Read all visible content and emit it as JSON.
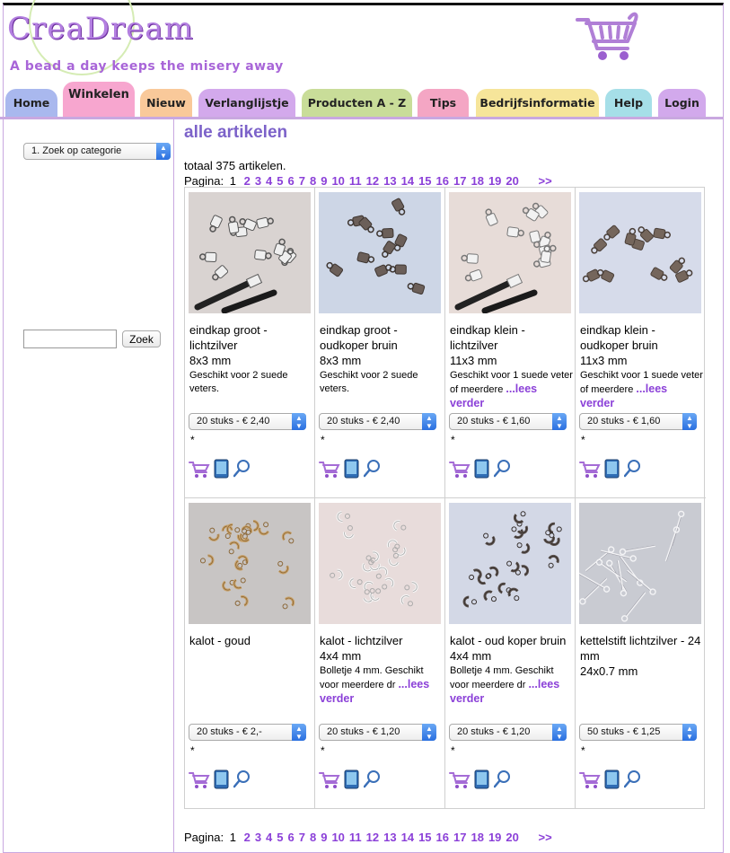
{
  "header": {
    "logo": "CreaDream",
    "tagline": "A bead a day keeps the misery away"
  },
  "colors": {
    "accent": "#8b40d8",
    "title": "#7c62c9",
    "frame": "#c9a8e0"
  },
  "tabs": [
    {
      "label": "Home",
      "color": "#a9b8ee"
    },
    {
      "label": "Winkelen",
      "color": "#f7a6cf",
      "active": true
    },
    {
      "label": "Nieuw",
      "color": "#f9c99a"
    },
    {
      "label": "Verlanglijstje",
      "color": "#d3a9ec"
    },
    {
      "label": "Producten A - Z",
      "color": "#c9dd99"
    },
    {
      "label": "Tips",
      "color": "#f4a6c4"
    },
    {
      "label": "Bedrijfsinformatie",
      "color": "#f6e59a"
    },
    {
      "label": "Help",
      "color": "#a6dfe8"
    },
    {
      "label": "Login",
      "color": "#d2a9ec"
    }
  ],
  "sidebar": {
    "category_select": "1. Zoek op categorie",
    "search_button": "Zoek",
    "search_value": ""
  },
  "main": {
    "title": "alle artikelen",
    "total": "totaal 375 artikelen.",
    "pagination": {
      "label": "Pagina:",
      "current": "1",
      "pages": [
        "2",
        "3",
        "4",
        "5",
        "6",
        "7",
        "8",
        "9",
        "10",
        "11",
        "12",
        "13",
        "14",
        "15",
        "16",
        "17",
        "18",
        "19",
        "20"
      ],
      "next": ">>"
    }
  },
  "products": [
    {
      "name": "eindkap groot - lichtzilver",
      "size": "8x3 mm",
      "desc": "Geschikt voor 2 suede veters.",
      "more": "",
      "option": "20 stuks - € 2,40",
      "star": "*",
      "image": {
        "bg": "#d9d3d1",
        "part": "#efefef",
        "dark": "#555",
        "style": "crimp",
        "cord": true
      }
    },
    {
      "name": "eindkap groot - oudkoper bruin",
      "size": "8x3 mm",
      "desc": "Geschikt voor 2 suede veters.",
      "more": "",
      "option": "20 stuks - € 2,40",
      "star": "*",
      "image": {
        "bg": "#cdd6e6",
        "part": "#6b5f59",
        "dark": "#3d3530",
        "style": "crimp",
        "cord": false
      }
    },
    {
      "name": "eindkap klein - lichtzilver",
      "size": "11x3 mm",
      "desc": "Geschikt voor 1 suede veter of meerdere ",
      "more": "...lees verder",
      "option": "20 stuks - € 1,60",
      "star": "*",
      "image": {
        "bg": "#e7dcd8",
        "part": "#f2f2f2",
        "dark": "#777",
        "style": "crimp",
        "cord": true
      }
    },
    {
      "name": "eindkap klein - oudkoper bruin",
      "size": "11x3 mm",
      "desc": "Geschikt voor 1 suede veter of meerdere ",
      "more": "...lees verder",
      "option": "20 stuks - € 1,60",
      "star": "*",
      "image": {
        "bg": "#d6dbea",
        "part": "#75665c",
        "dark": "#4a3f38",
        "style": "crimp",
        "cord": false
      }
    },
    {
      "name": "kalot - goud",
      "size": "",
      "desc": "",
      "more": "",
      "option": "20 stuks - € 2,-",
      "star": "*",
      "image": {
        "bg": "#c8c5c4",
        "part": "#c9a26a",
        "dark": "#8a6636",
        "style": "ring",
        "cord": false
      }
    },
    {
      "name": "kalot - lichtzilver",
      "size": "4x4 mm",
      "desc": "Bolletje 4 mm. Geschikt voor meerdere dr ",
      "more": "...lees verder",
      "option": "20 stuks - € 1,20",
      "star": "*",
      "image": {
        "bg": "#e8dcdb",
        "part": "#f6f6f6",
        "dark": "#aaa",
        "style": "ring",
        "cord": false
      }
    },
    {
      "name": "kalot - oud koper bruin",
      "size": "4x4 mm",
      "desc": "Bolletje 4 mm. Geschikt voor meerdere dr ",
      "more": "...lees verder",
      "option": "20 stuks - € 1,20",
      "star": "*",
      "image": {
        "bg": "#d3d8e6",
        "part": "#5d5450",
        "dark": "#332c29",
        "style": "ring",
        "cord": false
      }
    },
    {
      "name": "kettelstift lichtzilver - 24 mm",
      "size": "24x0.7 mm",
      "desc": "",
      "more": "",
      "option": "50 stuks - € 1,25",
      "star": "*",
      "image": {
        "bg": "#c9cbd2",
        "part": "#f4f4f6",
        "dark": "#9a9aa4",
        "style": "pin",
        "cord": false
      }
    }
  ]
}
